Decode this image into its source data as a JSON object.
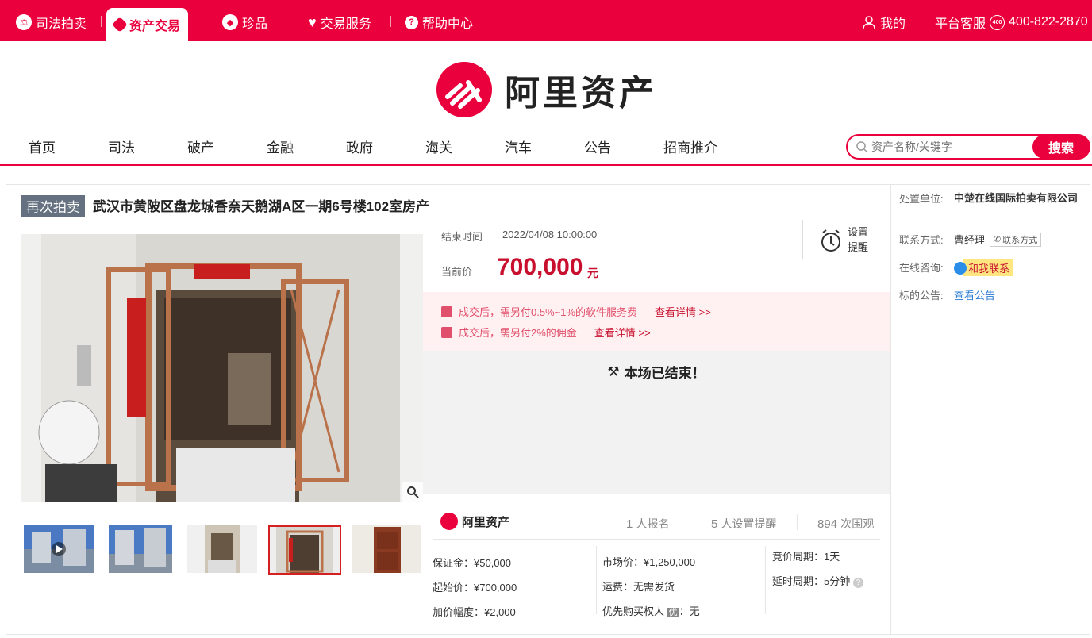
{
  "topbar": {
    "items": [
      {
        "label": "司法拍卖",
        "icon": "gavel-badge-icon"
      },
      {
        "label": "资产交易",
        "icon": "diamond-icon"
      },
      {
        "label": "珍品",
        "icon": "gem-icon"
      },
      {
        "label": "交易服务",
        "icon": "heart-icon"
      },
      {
        "label": "帮助中心",
        "icon": "question-icon"
      }
    ],
    "my": "我的",
    "service": "平台客服",
    "phone": "400-822-2870"
  },
  "brand": {
    "name": "阿里资产"
  },
  "nav": [
    "首页",
    "司法",
    "破产",
    "金融",
    "政府",
    "海关",
    "汽车",
    "公告",
    "招商推介"
  ],
  "search": {
    "placeholder": "资产名称/关键字",
    "button": "搜索"
  },
  "item": {
    "tag": "再次拍卖",
    "title": "武汉市黄陂区盘龙城香奈天鹅湖A区一期6号楼102室房产",
    "end_label": "结束时间",
    "end_time": "2022/04/08 10:00:00",
    "price_label": "当前价",
    "price": "700,000",
    "price_unit": "元",
    "remind": "设置提醒",
    "fees": [
      {
        "text": "成交后，需另付0.5%~1%的软件服务费",
        "link": "查看详情 >>"
      },
      {
        "text": "成交后，需另付2%的佣金",
        "link": "查看详情 >>"
      }
    ],
    "ended": "本场已结束！"
  },
  "stats": {
    "brand": "阿里资产",
    "signup_count": "1",
    "signup_label": "人报名",
    "remind_count": "5",
    "remind_label": "人设置提醒",
    "view_count": "894",
    "view_label": "次围观"
  },
  "details": {
    "col1": [
      "保证金：¥50,000",
      "起始价：¥700,000",
      "加价幅度：¥2,000"
    ],
    "col2": [
      "市场价：¥1,250,000",
      "运费：无需发货",
      "优先购买权人"
    ],
    "col2_badge": "优",
    "col2_badge_suffix": "：无",
    "col3": [
      "竞价周期：1天",
      "延时周期：5分钟"
    ]
  },
  "sidebar": {
    "unit_label": "处置单位:",
    "unit_value": "中楚在线国际拍卖有限公司",
    "contact_label": "联系方式:",
    "contact_value": "曹经理",
    "contact_btn": "联系方式",
    "consult_label": "在线咨询:",
    "consult_btn": "和我联系",
    "notice_label": "标的公告:",
    "notice_link": "查看公告"
  },
  "colors": {
    "brand": "#e9003c",
    "price": "#c8102e",
    "link": "#2a7bd2"
  }
}
